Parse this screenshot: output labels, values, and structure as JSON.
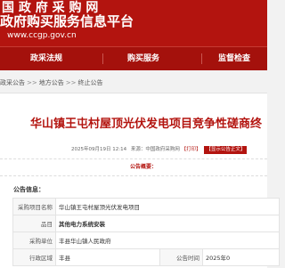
{
  "site": {
    "title_line1": "国 政 府 采 购 网",
    "title_line2": "政府购买服务信息平台",
    "url": "www.ccgp.gov.cn"
  },
  "nav": {
    "items": [
      "政采法规",
      "购买服务",
      "监督检查"
    ]
  },
  "breadcrumb": {
    "items": [
      "政采公告",
      "地方公告",
      "终止公告"
    ],
    "separator": ">>"
  },
  "notice": {
    "title": "华山镇王屯村屋顶光伏发电项目竞争性磋商终",
    "meta": {
      "date": "2025年09月19日 12:14",
      "source_label": "来源：",
      "source": "中国政府采购网",
      "print": "【打印】",
      "tip": "【显示公告正文】"
    },
    "summary_label": "公告概要："
  },
  "info": {
    "heading": "公告信息：",
    "rows": [
      {
        "key": "采购项目名称",
        "value": "华山镇王屯村屋顶光伏发电项目",
        "bold": false
      },
      {
        "key": "品目",
        "value": "其他电力系统安装",
        "bold": true
      },
      {
        "key": "采购单位",
        "value": "丰县华山镇人民政府",
        "bold": false
      },
      {
        "key": "行政区域",
        "value": "丰县",
        "extra_key": "公告时间",
        "extra_value": "2025年0",
        "bold": false
      }
    ]
  },
  "colors": {
    "brand_red": "#b3140f",
    "nav_red": "#a4110c"
  }
}
